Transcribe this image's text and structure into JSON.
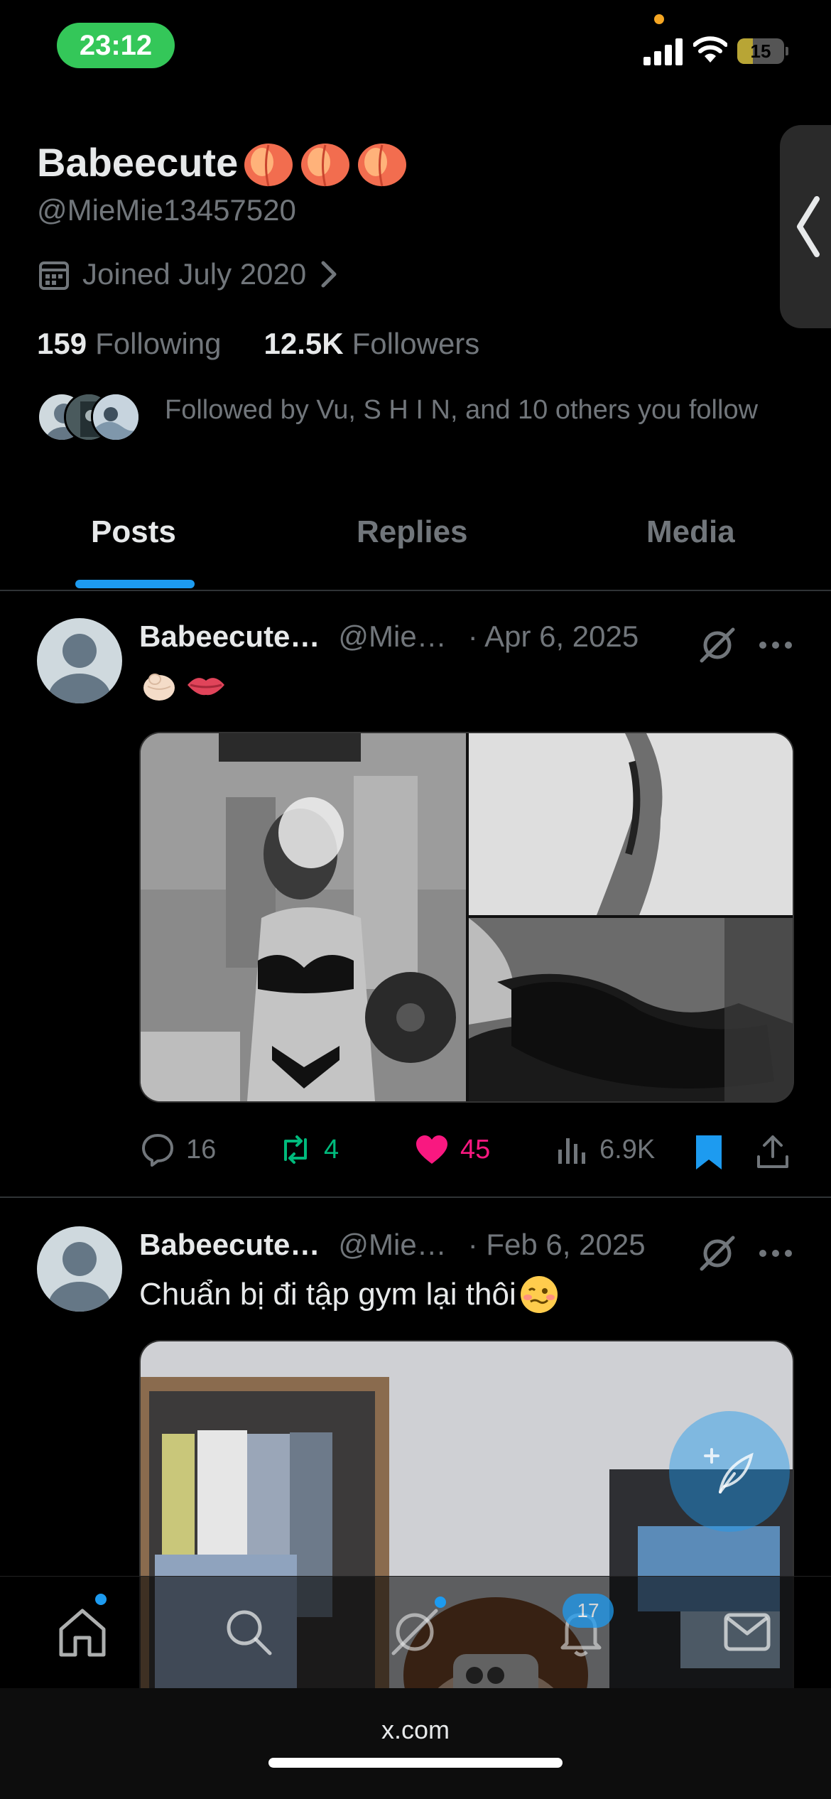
{
  "status_bar": {
    "time": "23:12",
    "battery": "15",
    "battery_level": 0.15
  },
  "profile": {
    "name": "Babeecute",
    "name_emoji": [
      "peach",
      "peach",
      "peach"
    ],
    "handle": "@MieMie13457520",
    "joined": "Joined July 2020",
    "following_count": "159",
    "following_label": "Following",
    "followers_count": "12.5K",
    "followers_label": "Followers",
    "followed_by": "Followed by Vu, S H I N, and 10 others you follow"
  },
  "tabs": [
    {
      "label": "Posts",
      "active": true
    },
    {
      "label": "Replies",
      "active": false
    },
    {
      "label": "Media",
      "active": false
    }
  ],
  "posts": [
    {
      "name": "Babeecute…",
      "handle": "@Mie…",
      "date": "· Apr 6, 2025",
      "text_emoji": [
        "pointing-fist-emoji",
        "lips-emoji"
      ],
      "replies": "16",
      "reposts": "4",
      "likes": "45",
      "views": "6.9K",
      "liked": true,
      "bookmarked": true
    },
    {
      "name": "Babeecute…",
      "handle": "@Mie…",
      "date": "· Feb 6, 2025",
      "text": "Chuẩn bị đi tập gym lại thôi",
      "text_emoji": [
        "woozy-face-emoji"
      ]
    }
  ],
  "bottom_nav": {
    "items": [
      "home-icon",
      "search-icon",
      "grok-icon",
      "notifications-icon",
      "messages-icon"
    ],
    "notifications_badge": "17"
  },
  "browser": {
    "url": "x.com"
  },
  "colors": {
    "accent": "#1d9bf0",
    "like": "#f91880",
    "repost": "#00ba7c",
    "muted": "#71767b"
  }
}
